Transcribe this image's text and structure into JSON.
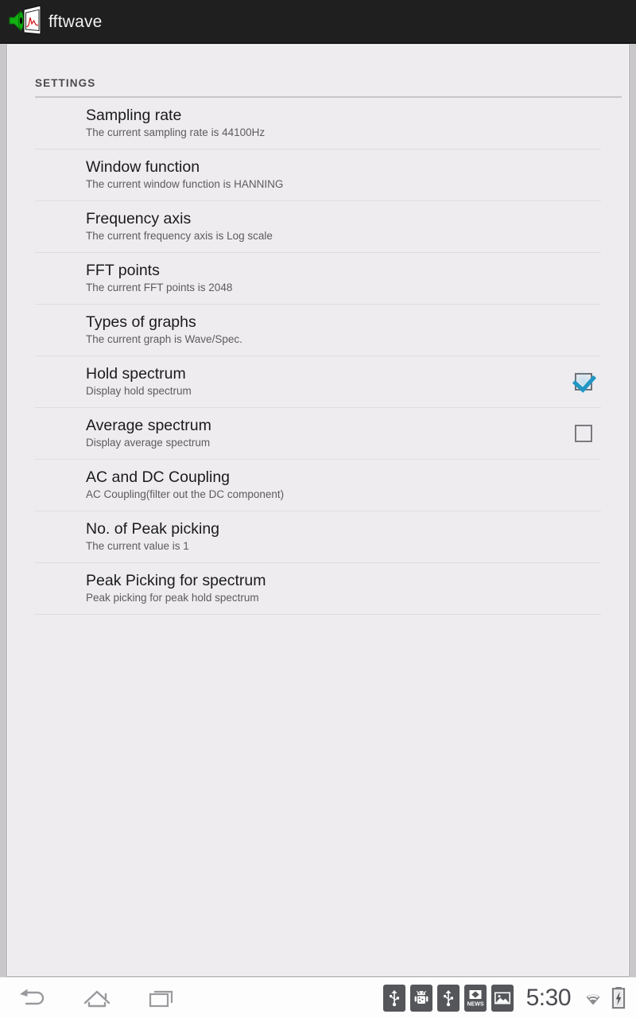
{
  "app": {
    "title": "fftwave",
    "icon": "fftwave-app-icon"
  },
  "panel": {
    "section_header": "SETTINGS"
  },
  "settings": [
    {
      "title": "Sampling rate",
      "summary": "The current sampling rate is 44100Hz",
      "widget": "none",
      "checked": false,
      "name": "sampling-rate"
    },
    {
      "title": "Window function",
      "summary": "The current window function is HANNING",
      "widget": "none",
      "checked": false,
      "name": "window-function"
    },
    {
      "title": "Frequency axis",
      "summary": "The current frequency axis is Log scale",
      "widget": "none",
      "checked": false,
      "name": "frequency-axis"
    },
    {
      "title": "FFT points",
      "summary": "The current FFT points is 2048",
      "widget": "none",
      "checked": false,
      "name": "fft-points"
    },
    {
      "title": "Types of graphs",
      "summary": "The current graph is Wave/Spec.",
      "widget": "none",
      "checked": false,
      "name": "types-of-graphs"
    },
    {
      "title": "Hold spectrum",
      "summary": "Display hold spectrum",
      "widget": "checkbox",
      "checked": true,
      "name": "hold-spectrum"
    },
    {
      "title": "Average spectrum",
      "summary": "Display average spectrum",
      "widget": "checkbox",
      "checked": false,
      "name": "average-spectrum"
    },
    {
      "title": "AC and DC Coupling",
      "summary": "AC Coupling(filter out the DC component)",
      "widget": "none",
      "checked": false,
      "name": "ac-dc-coupling"
    },
    {
      "title": "No. of Peak picking",
      "summary": "The current value is 1",
      "widget": "none",
      "checked": false,
      "name": "no-of-peak-picking"
    },
    {
      "title": "Peak Picking for spectrum",
      "summary": "Peak picking for peak hold spectrum",
      "widget": "none",
      "checked": false,
      "name": "peak-picking-for-spectrum"
    }
  ],
  "navigation": {
    "back": "back-icon",
    "home": "home-icon",
    "recents": "recent-apps-icon"
  },
  "status_bar": {
    "notifications": [
      "usb-icon",
      "android-debug-icon",
      "usb-icon",
      "news-icon",
      "image-icon"
    ],
    "clock": "5:30",
    "wifi": "wifi-icon",
    "battery": "battery-charging-icon"
  },
  "colors": {
    "accent": "#2196c4",
    "action_bar": "#1f1f1f",
    "panel_bg": "#eeecef",
    "divider": "#dfdde0",
    "title_text": "#1b1b1b",
    "summary_text": "#5d5b5e"
  }
}
